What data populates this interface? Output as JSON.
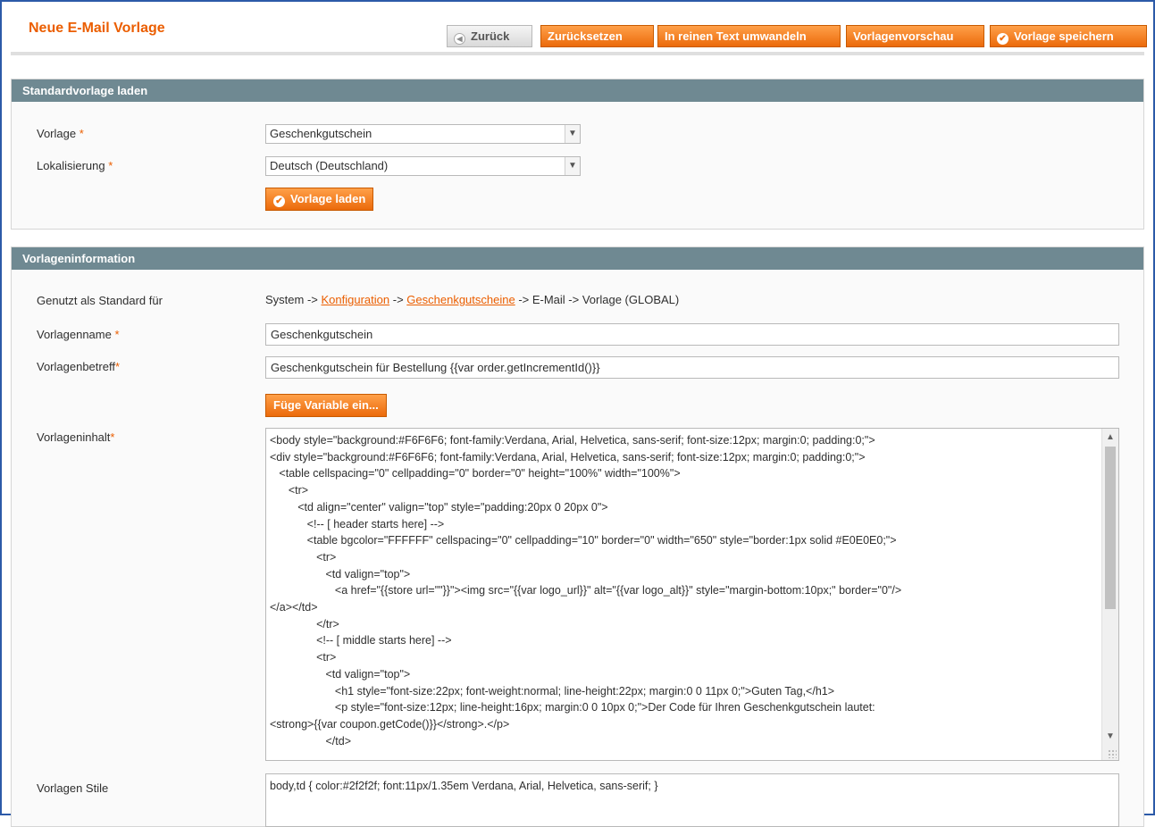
{
  "header": {
    "title": "Neue E-Mail Vorlage",
    "buttons": {
      "back": "Zurück",
      "reset": "Zurücksetzen",
      "convert_text": "In reinen Text umwandeln",
      "preview": "Vorlagenvorschau",
      "save": "Vorlage speichern"
    }
  },
  "load_section": {
    "title": "Standardvorlage laden",
    "template_label": "Vorlage",
    "template_value": "Geschenkgutschein",
    "locale_label": "Lokalisierung",
    "locale_value": "Deutsch (Deutschland)",
    "load_button": "Vorlage laden",
    "required_mark": "*"
  },
  "info_section": {
    "title": "Vorlageninformation",
    "used_as_default_label": "Genutzt als Standard für",
    "path": {
      "prefix": "System -> ",
      "link1": "Konfiguration",
      "sep1": " -> ",
      "link2": "Geschenkgutscheine",
      "suffix": " -> E-Mail -> Vorlage  (GLOBAL)"
    },
    "name_label": "Vorlagenname",
    "name_value": "Geschenkgutschein",
    "subject_label": "Vorlagenbetreff",
    "subject_value": "Geschenkgutschein für Bestellung {{var order.getIncrementId()}}",
    "insert_variable_button": "Füge Variable ein...",
    "content_label": "Vorlageninhalt",
    "content_lines": [
      "<body style=\"background:#F6F6F6; font-family:Verdana, Arial, Helvetica, sans-serif; font-size:12px; margin:0; padding:0;\">",
      "<div style=\"background:#F6F6F6; font-family:Verdana, Arial, Helvetica, sans-serif; font-size:12px; margin:0; padding:0;\">",
      "   <table cellspacing=\"0\" cellpadding=\"0\" border=\"0\" height=\"100%\" width=\"100%\">",
      "      <tr>",
      "         <td align=\"center\" valign=\"top\" style=\"padding:20px 0 20px 0\">",
      "            <!-- [ header starts here] -->",
      "            <table bgcolor=\"FFFFFF\" cellspacing=\"0\" cellpadding=\"10\" border=\"0\" width=\"650\" style=\"border:1px solid #E0E0E0;\">",
      "               <tr>",
      "                  <td valign=\"top\">",
      "                     <a href=\"{{store url=\"\"}}\"><img src=\"{{var logo_url}}\" alt=\"{{var logo_alt}}\" style=\"margin-bottom:10px;\" border=\"0\"/>",
      "</a></td>",
      "               </tr>",
      "               <!-- [ middle starts here] -->",
      "               <tr>",
      "                  <td valign=\"top\">",
      "                     <h1 style=\"font-size:22px; font-weight:normal; line-height:22px; margin:0 0 11px 0;\">Guten Tag,</h1>",
      "                     <p style=\"font-size:12px; line-height:16px; margin:0 0 10px 0;\">Der Code für Ihren Geschenkgutschein lautet:",
      "<strong>{{var coupon.getCode()}}</strong>.</p>",
      "                  </td>"
    ],
    "styles_label": "Vorlagen Stile",
    "styles_value": "body,td { color:#2f2f2f; font:11px/1.35em Verdana, Arial, Helvetica, sans-serif; }"
  },
  "colors": {
    "accent": "#eb5e00",
    "button": "#f77c16",
    "section_header": "#6f8992"
  },
  "icons": {
    "back": "back-arrow-icon",
    "check": "check-circle-icon",
    "dropdown": "chevron-down-icon"
  }
}
